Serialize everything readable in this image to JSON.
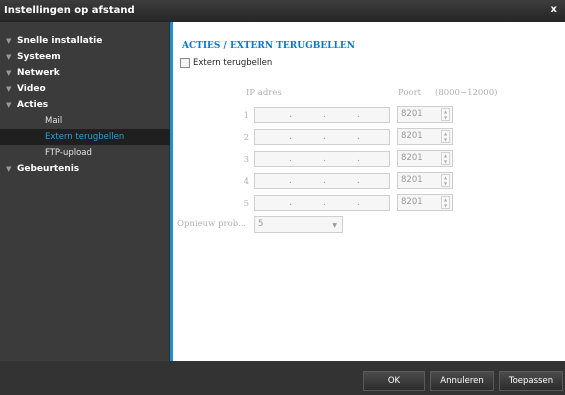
{
  "window": {
    "title": "Instellingen op afstand"
  },
  "sidebar": {
    "items": [
      {
        "label": "Snelle installatie"
      },
      {
        "label": "Systeem"
      },
      {
        "label": "Netwerk"
      },
      {
        "label": "Video"
      },
      {
        "label": "Acties"
      },
      {
        "label": "Gebeurtenis"
      }
    ],
    "sub": [
      {
        "label": "Mail"
      },
      {
        "label": "Extern terugbellen"
      },
      {
        "label": "FTP-upload"
      }
    ]
  },
  "main": {
    "title": "ACTIES / EXTERN TERUGBELLEN",
    "checkbox_label": "Extern terugbellen",
    "ip_header": "IP adres",
    "port_header": "Poort",
    "port_range": "(8000~12000)",
    "rows": [
      {
        "num": "1",
        "port": "8201"
      },
      {
        "num": "2",
        "port": "8201"
      },
      {
        "num": "3",
        "port": "8201"
      },
      {
        "num": "4",
        "port": "8201"
      },
      {
        "num": "5",
        "port": "8201"
      }
    ],
    "retry_label": "Opnieuw prob...",
    "retry_value": "5"
  },
  "footer": {
    "ok": "OK",
    "cancel": "Annuleren",
    "apply": "Toepassen"
  }
}
